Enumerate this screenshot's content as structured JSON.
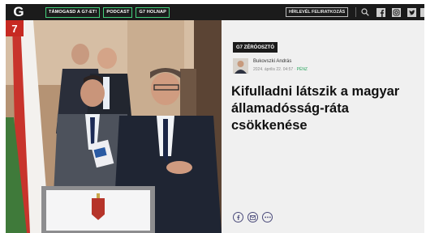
{
  "header": {
    "logo_text": "G",
    "nav": [
      {
        "label": "TÁMOGASD A G7-ET!"
      },
      {
        "label": "PODCAST"
      },
      {
        "label": "G7 HOLNAP"
      }
    ],
    "newsletter_label": "HÍRLEVÉL FELIRATKOZÁS",
    "icons": [
      "search-icon",
      "facebook-icon",
      "instagram-icon",
      "twitter-icon",
      "menu-icon"
    ],
    "accent_color": "#43d17d"
  },
  "hero": {
    "badge_text": "7",
    "alt": ""
  },
  "article": {
    "category": "G7 ZÉRÓOSZTÓ",
    "author": "Bukovszki András",
    "date": "2024. április 22. 04:57",
    "separator": " · ",
    "section": "PÉNZ",
    "title": "Kifulladni látszik a magyar államadósság-ráta csökkenése",
    "share_icons": [
      "facebook-icon",
      "email-icon",
      "more-icon"
    ]
  }
}
